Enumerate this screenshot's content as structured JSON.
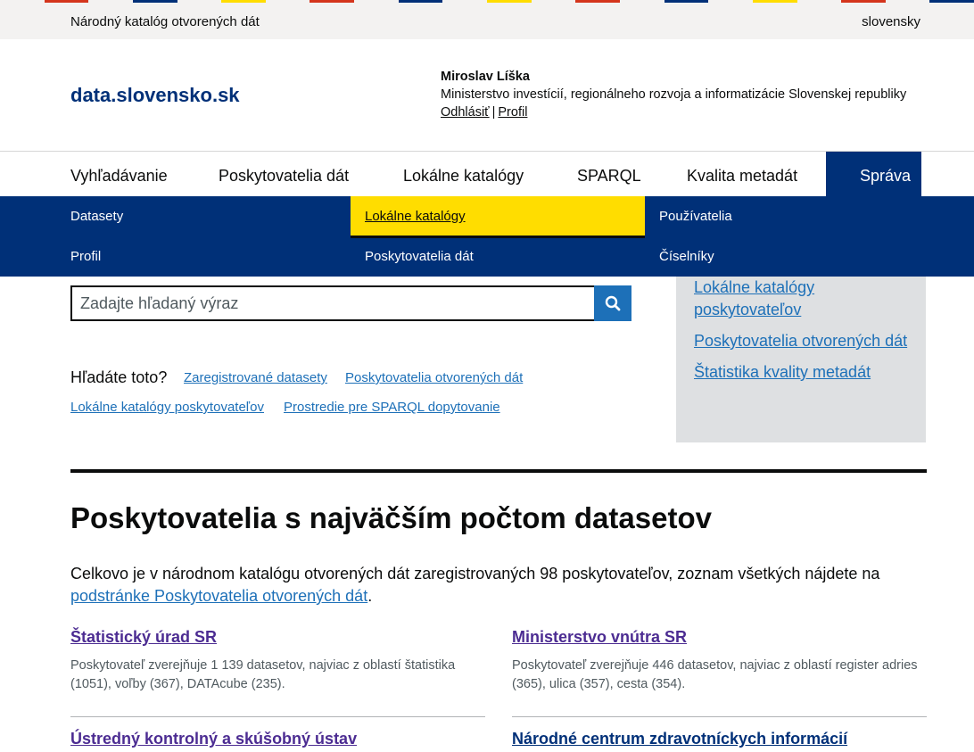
{
  "stripe_colors": [
    "#d4351c",
    "#003078",
    "#ffdd00",
    "#f3f2f1"
  ],
  "topbar": {
    "site_name": "Národný katalóg otvorených dát",
    "language": "slovensky"
  },
  "header": {
    "logo": "data.slovensko.sk",
    "user": {
      "name": "Miroslav Líška",
      "organization": "Ministerstvo investícií, regionálneho rozvoja a informatizácie Slovenskej republiky",
      "logout": "Odhlásiť",
      "separator": "|",
      "profile": "Profil"
    }
  },
  "nav": {
    "items": [
      "Vyhľadávanie",
      "Poskytovatelia dát",
      "Lokálne katalógy",
      "SPARQL",
      "Kvalita metadát"
    ],
    "active": "Správa"
  },
  "submenu": {
    "datasets": "Datasety",
    "local_catalogs": "Lokálne katalógy",
    "users": "Používatelia",
    "profile": "Profil",
    "data_providers": "Poskytovatelia dát",
    "codelists": "Číselníky"
  },
  "search": {
    "placeholder": "Zadajte hľadaný výraz",
    "icon": "search-icon"
  },
  "sidebar": {
    "links": [
      "Lokálne katalógy poskytovateľov",
      "Poskytovatelia otvorených dát",
      "Štatistika kvality metadát"
    ]
  },
  "hints": {
    "label": "Hľadáte toto?",
    "links": [
      "Zaregistrované datasety",
      "Poskytovatelia otvorených dát",
      "Lokálne katalógy poskytovateľov",
      "Prostredie pre SPARQL dopytovanie"
    ]
  },
  "providers_section": {
    "title": "Poskytovatelia s najväčším počtom datasetov",
    "intro_text": "Celkovo je v národnom katalógu otvorených dát zaregistrovaných 98 poskytovateľov, zoznam všetkých nájdete na",
    "intro_link": "podstránke Poskytovatelia otvorených dát",
    "intro_end": ".",
    "providers": [
      {
        "name": "Štatistický úrad SR",
        "desc": "Poskytovateľ zverejňuje 1 139 datasetov, najviac z oblastí štatistika (1051), voľby (367), DATAcube (235)."
      },
      {
        "name": "Ministerstvo vnútra SR",
        "desc": "Poskytovateľ zverejňuje 446 datasetov, najviac z oblastí register adries (365), ulica (357), cesta (354)."
      },
      {
        "name": "Ústredný kontrolný a skúšobný ústav",
        "desc": ""
      },
      {
        "name": "Národné centrum zdravotníckych informácií",
        "desc": ""
      }
    ]
  }
}
